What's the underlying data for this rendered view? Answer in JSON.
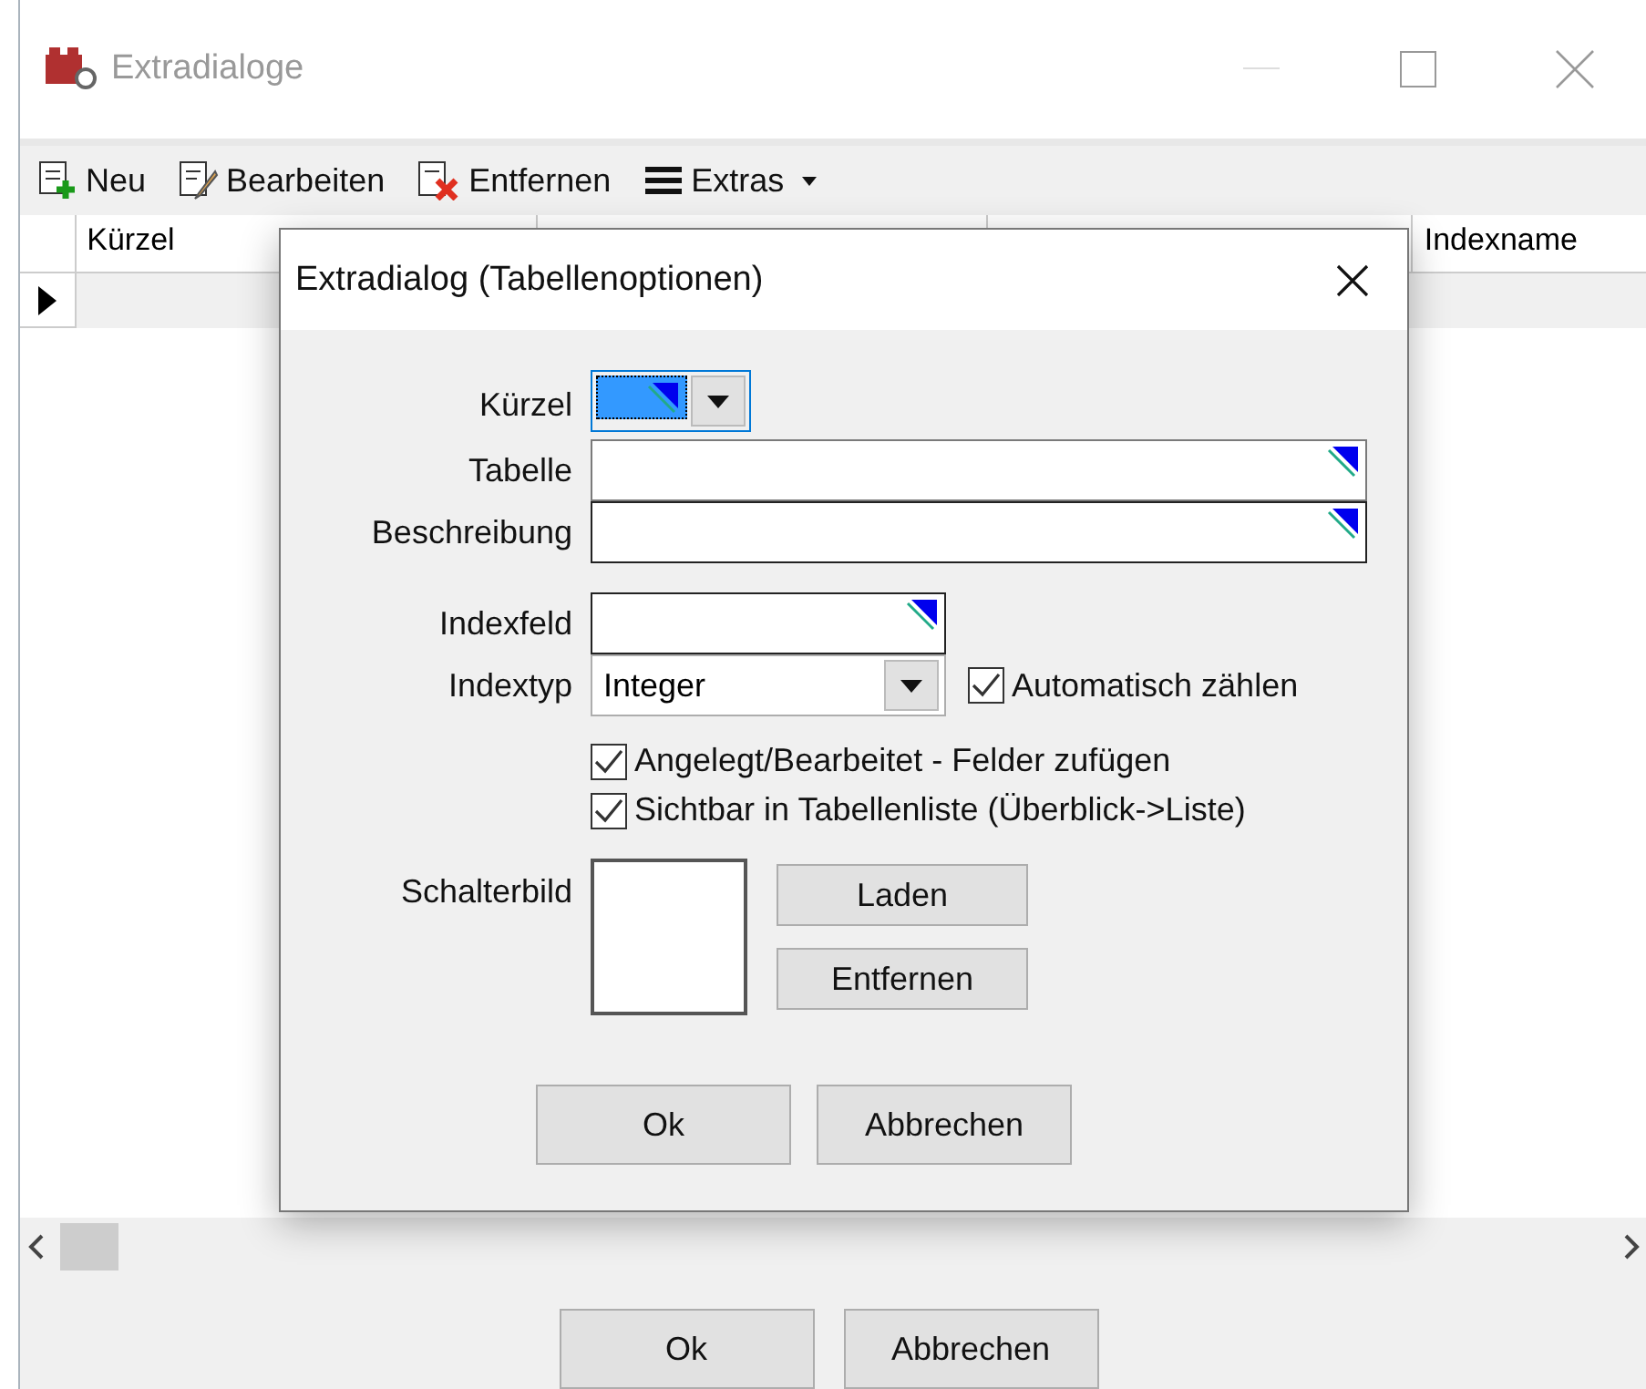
{
  "window": {
    "title": "Extradialoge"
  },
  "toolbar": [
    {
      "label": "Neu",
      "kind": "new"
    },
    {
      "label": "Bearbeiten",
      "kind": "edit"
    },
    {
      "label": "Entfernen",
      "kind": "delete"
    },
    {
      "label": "Extras",
      "kind": "menu"
    }
  ],
  "table": {
    "columns": [
      "Kürzel",
      "",
      "",
      "Indexname"
    ]
  },
  "dialog": {
    "title": "Extradialog (Tabellenoptionen)",
    "fields": {
      "kuerzel": {
        "label": "Kürzel"
      },
      "tabelle": {
        "label": "Tabelle"
      },
      "beschreibung": {
        "label": "Beschreibung"
      },
      "indexfeld": {
        "label": "Indexfeld"
      },
      "indextyp": {
        "label": "Indextyp",
        "value": "Integer"
      }
    },
    "checkboxes": [
      {
        "label": "Automatisch zählen",
        "checked": true
      },
      {
        "label": "Angelegt/Bearbeitet - Felder zufügen",
        "checked": true
      },
      {
        "label": "Sichtbar in Tabellenliste (Überblick->Liste)",
        "checked": true
      }
    ],
    "image": {
      "label": "Schalterbild",
      "buttons": [
        "Laden",
        "Entfernen"
      ]
    },
    "buttons": [
      "Ok",
      "Abbrechen"
    ]
  },
  "buttons": [
    "Ok",
    "Abbrechen"
  ]
}
